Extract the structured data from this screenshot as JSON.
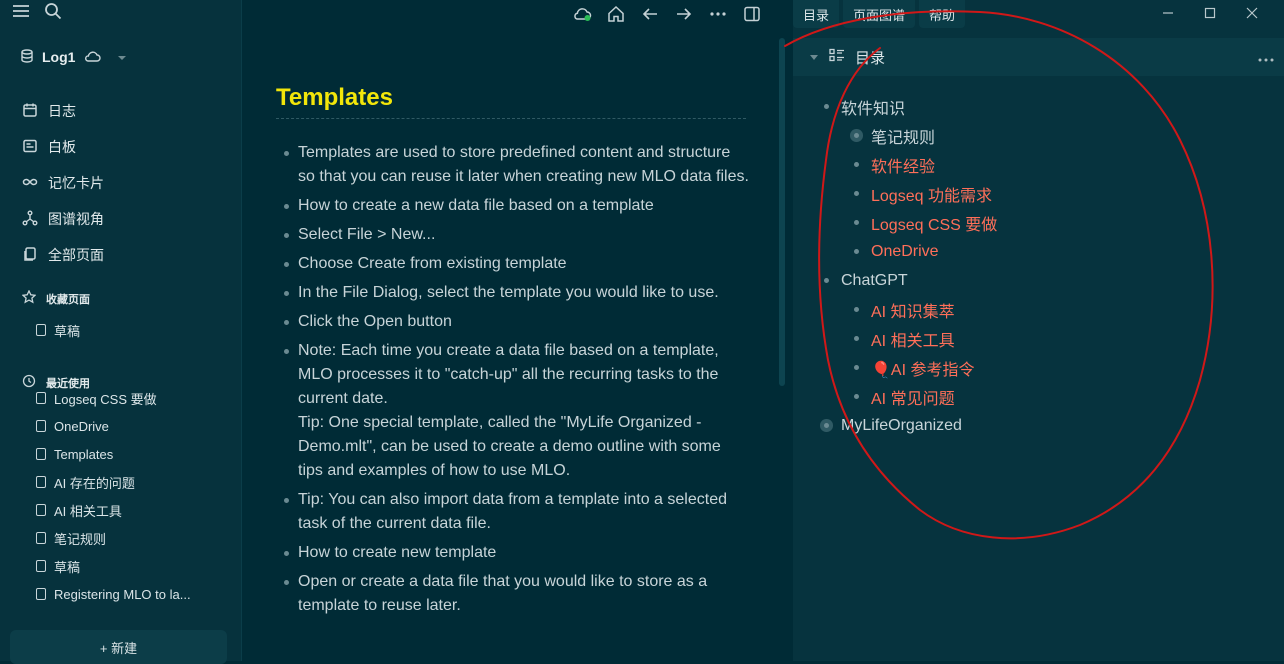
{
  "sidebar": {
    "graph_name": "Log1",
    "nav": [
      {
        "icon": "calendar-icon",
        "label": "日志"
      },
      {
        "icon": "whiteboard-icon",
        "label": "白板"
      },
      {
        "icon": "infinity-icon",
        "label": "记忆卡片"
      },
      {
        "icon": "graph-icon",
        "label": "图谱视角"
      },
      {
        "icon": "pages-icon",
        "label": "全部页面"
      }
    ],
    "favorites_title": "收藏页面",
    "favorites": [
      "草稿"
    ],
    "recent_title": "最近使用",
    "recent": [
      "Logseq CSS 要做",
      "OneDrive",
      "Templates",
      "AI 存在的问题",
      "AI 相关工具",
      "笔记规则",
      "草稿",
      "Registering MLO to la..."
    ],
    "new_button": "+ 新建"
  },
  "main": {
    "title": "Templates",
    "blocks": [
      "Templates are used to store predefined content and structure so that you can reuse it later when creating new MLO data files.",
      "How to create a new data file based on a template",
      "Select File > New...",
      "Choose Create from existing template",
      "In the File Dialog, select the template you would like to use.",
      "Click the Open button",
      "Note: Each time you create a data file based on a template, MLO processes it to \"catch-up\" all the recurring tasks to the current date.",
      "Tip: One special template, called the \"MyLife Organized - Demo.mlt\", can be used to create a demo outline with some tips and examples of how to use MLO.",
      "Tip: You can also import data from a template into a selected task of the current data file.",
      "How to create new template",
      "Open or create a data file that you would like to store as a template to reuse later."
    ]
  },
  "right": {
    "tabs": [
      "目录",
      "页面图谱",
      "帮助"
    ],
    "toc_title": "目录",
    "toc": [
      {
        "level": 0,
        "label": "软件知识",
        "color": "plain"
      },
      {
        "level": 1,
        "label": "笔记规则",
        "color": "plain",
        "ring": true
      },
      {
        "level": 1,
        "label": "软件经验"
      },
      {
        "level": 1,
        "label": "Logseq 功能需求"
      },
      {
        "level": 1,
        "label": "Logseq CSS 要做"
      },
      {
        "level": 1,
        "label": "OneDrive"
      },
      {
        "level": 0,
        "label": "ChatGPT",
        "color": "plain"
      },
      {
        "level": 1,
        "label": "AI 知识集萃"
      },
      {
        "level": 1,
        "label": "AI 相关工具"
      },
      {
        "level": 1,
        "label": "🎈AI 参考指令"
      },
      {
        "level": 1,
        "label": "AI 常见问题"
      },
      {
        "level": 0,
        "label": "MyLifeOrganized",
        "color": "plain",
        "ring": true
      }
    ]
  },
  "colors": {
    "title": "#f2e60a",
    "link": "#ff6f59",
    "annotation": "#d01818",
    "bg": "#002b36"
  }
}
